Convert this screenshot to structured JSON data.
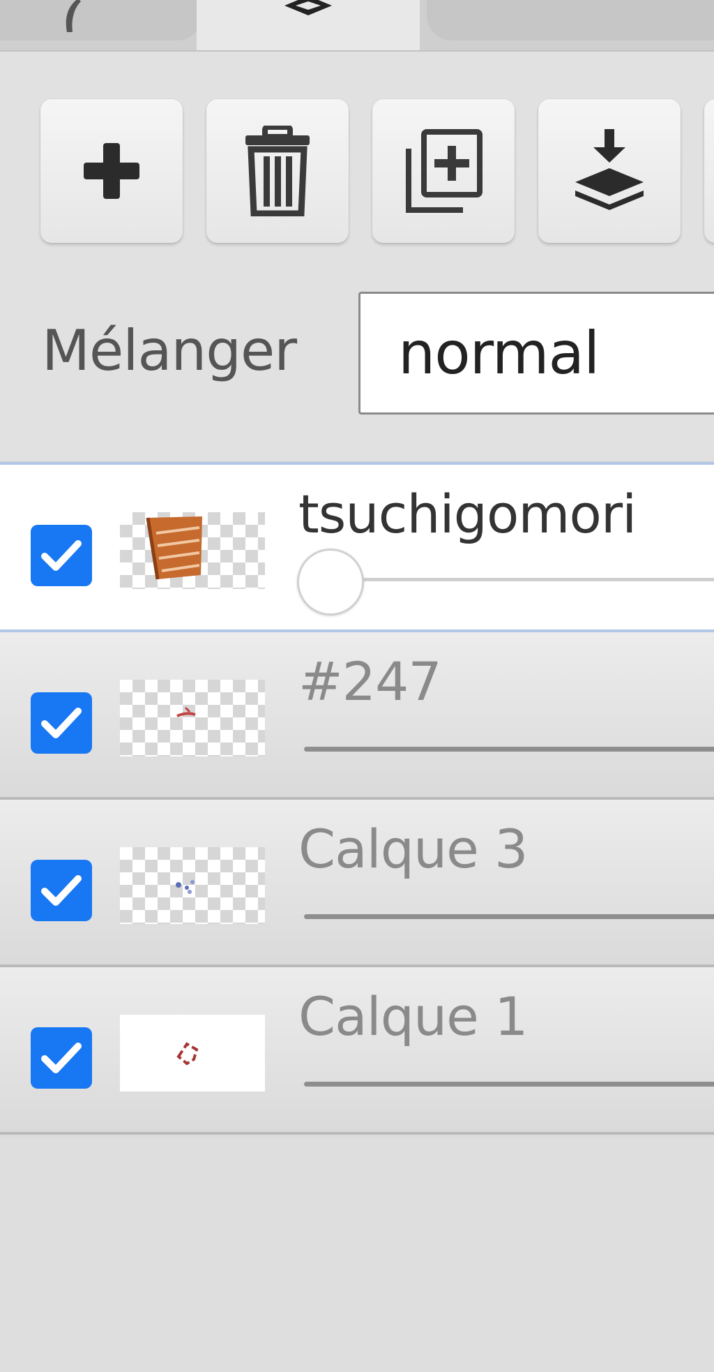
{
  "tabs": {
    "items": [
      {
        "name": "brush",
        "icon": "brush-icon",
        "active": false
      },
      {
        "name": "layers",
        "icon": "layers-icon",
        "active": true
      },
      {
        "name": "other",
        "icon": "",
        "active": false
      }
    ]
  },
  "toolbar": {
    "buttons": [
      {
        "icon": "plus-icon"
      },
      {
        "icon": "trash-icon"
      },
      {
        "icon": "duplicate-icon"
      },
      {
        "icon": "merge-down-icon"
      }
    ]
  },
  "blend": {
    "label": "Mélanger",
    "value": "normal"
  },
  "layers": [
    {
      "name": "tsuchigomori",
      "visible": true,
      "selected": true,
      "thumb": "brown-stripes"
    },
    {
      "name": "#247",
      "visible": true,
      "selected": false,
      "thumb": "red-stroke"
    },
    {
      "name": "Calque 3",
      "visible": true,
      "selected": false,
      "thumb": "blue-dots"
    },
    {
      "name": "Calque 1",
      "visible": true,
      "selected": false,
      "thumb": "red-outline"
    }
  ],
  "colors": {
    "checkbox": "#1877f2",
    "selected_border": "#b2c6e6"
  }
}
